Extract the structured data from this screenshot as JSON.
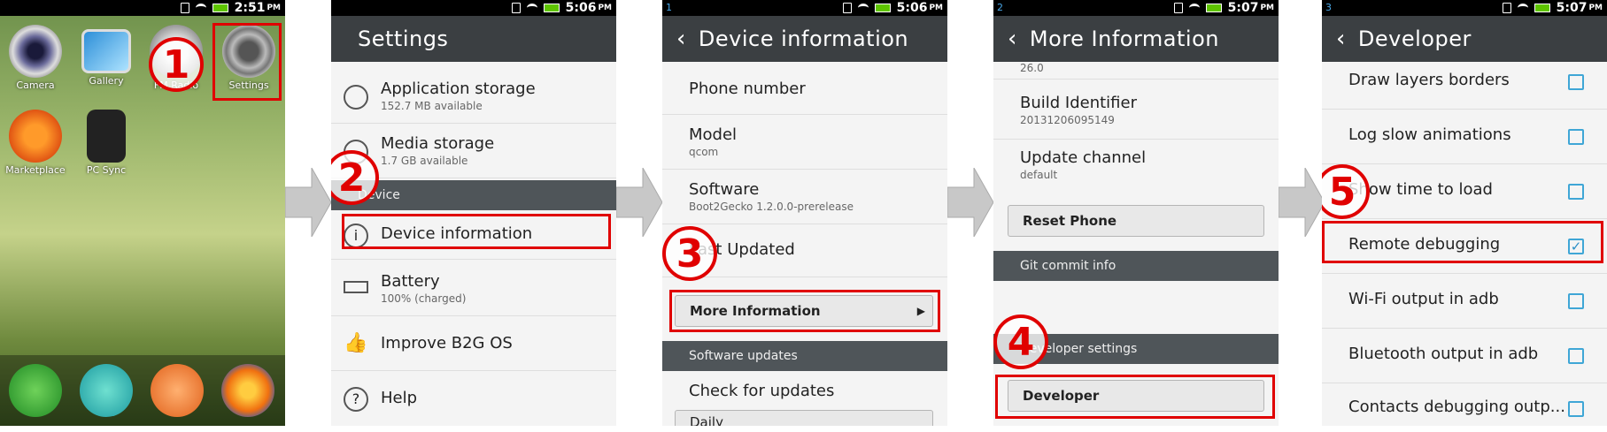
{
  "status": {
    "time1": "2:51",
    "time2": "5:06",
    "time3": "5:06",
    "time4": "5:07",
    "time5": "5:07",
    "ampm": "PM",
    "notif3": "1",
    "notif4": "2",
    "notif5": "3"
  },
  "homescreen": {
    "apps": [
      "Camera",
      "Gallery",
      "FM Radio",
      "Settings",
      "Marketplace",
      "PC Sync"
    ],
    "dock_icons": [
      "phone-icon",
      "messages-icon",
      "contacts-icon",
      "firefox-icon"
    ]
  },
  "settings": {
    "title": "Settings",
    "items": [
      {
        "title": "Application storage",
        "sub": "152.7 MB available"
      },
      {
        "title": "Media storage",
        "sub": "1.7 GB available"
      }
    ],
    "section_device": "Device",
    "device_information": "Device information",
    "battery": {
      "title": "Battery",
      "sub": "100% (charged)"
    },
    "improve": "Improve B2G OS",
    "help": "Help"
  },
  "device_info": {
    "title": "Device information",
    "phone_number": "Phone number",
    "model": {
      "title": "Model",
      "sub": "qcom"
    },
    "software": {
      "title": "Software",
      "sub": "Boot2Gecko 1.2.0.0-prerelease"
    },
    "last_updated": "Last Updated",
    "more_info_button": "More Information",
    "section_updates": "Software updates",
    "check_updates": "Check for updates",
    "daily": "Daily"
  },
  "more_info": {
    "title": "More Information",
    "top_value": "26.0",
    "build": {
      "title": "Build Identifier",
      "sub": "20131206095149"
    },
    "channel": {
      "title": "Update channel",
      "sub": "default"
    },
    "reset_button": "Reset Phone",
    "section_git": "Git commit info",
    "section_dev": "Developer settings",
    "developer_button": "Developer"
  },
  "developer": {
    "title": "Developer",
    "items": [
      {
        "label": "Draw layers borders",
        "checked": false
      },
      {
        "label": "Log slow animations",
        "checked": false
      },
      {
        "label": "Show time to load",
        "checked": false
      },
      {
        "label": "Remote debugging",
        "checked": true
      },
      {
        "label": "Wi-Fi output in adb",
        "checked": false
      },
      {
        "label": "Bluetooth output in adb",
        "checked": false
      },
      {
        "label": "Contacts debugging outp...",
        "checked": false
      }
    ],
    "check_mark": "✓"
  },
  "steps": [
    "1",
    "2",
    "3",
    "4",
    "5"
  ],
  "colors": {
    "highlight": "#e00000",
    "header": "#3b3f42",
    "section": "#4f5559",
    "checkbox": "#3fa6d6"
  }
}
